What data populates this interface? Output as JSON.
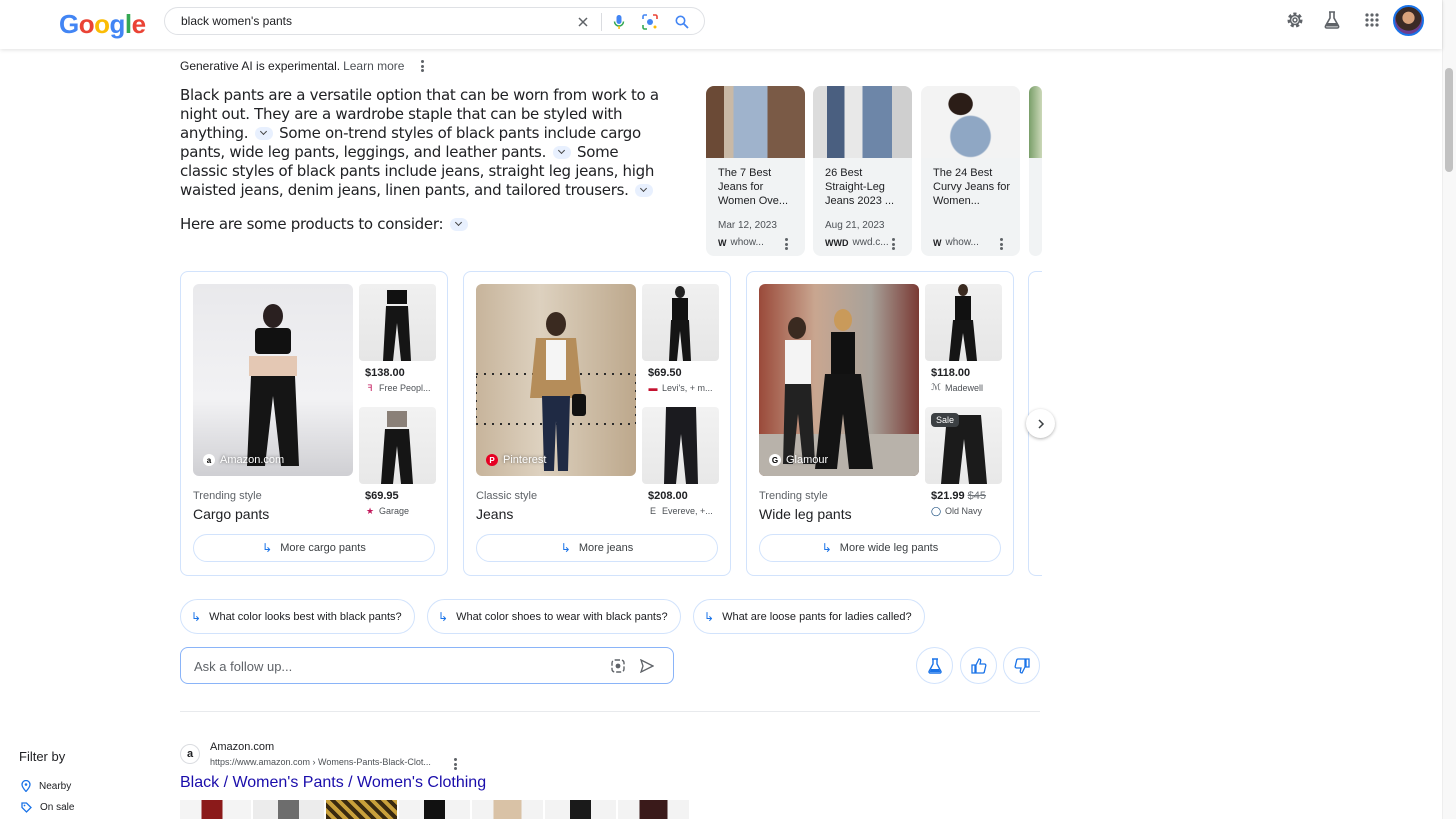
{
  "header": {
    "logo": [
      "G",
      "o",
      "o",
      "g",
      "l",
      "e"
    ],
    "logo_colors": [
      "#4285f4",
      "#ea4335",
      "#fbbc05",
      "#4285f4",
      "#34a853",
      "#ea4335"
    ],
    "query": "black women's pants",
    "icons": [
      "clear-icon",
      "mic-icon",
      "lens-icon",
      "search-icon",
      "settings-icon",
      "labs-icon",
      "apps-icon",
      "avatar"
    ]
  },
  "ai_overview": {
    "gen_note": "Generative AI is experimental.",
    "learn_more": "Learn more",
    "para": [
      "Black pants are a versatile option that can be worn from work to a night out. They are a wardrobe staple that can be styled with anything.",
      "Some on-trend styles of black pants include cargo pants, wide leg pants, leggings, and leather pants.",
      "Some classic styles of black pants include jeans, straight leg jeans, high waisted jeans, denim jeans, linen pants, and tailored trousers."
    ],
    "consider": "Here are some products to consider:",
    "sources": [
      {
        "title": "The 7 Best Jeans for Women Ove...",
        "date": "Mar 12, 2023",
        "site": "whow...",
        "favicon": "W"
      },
      {
        "title": "26 Best Straight-Leg Jeans 2023 ...",
        "date": "Aug 21, 2023",
        "site": "wwd.c...",
        "favicon": "WWD"
      },
      {
        "title": "The 24 Best Curvy Jeans for Women...",
        "date": "",
        "site": "whow...",
        "favicon": "W"
      }
    ]
  },
  "products": [
    {
      "source": "Amazon.com",
      "source_icon": "a",
      "kind": "Trending style",
      "name": "Cargo pants",
      "more": "More cargo pants",
      "items": [
        {
          "price": "$138.00",
          "was": "",
          "merchant": "Free Peopl...",
          "icon": "ꟻ",
          "sale": ""
        },
        {
          "price": "$69.95",
          "was": "",
          "merchant": "Garage",
          "icon": "★",
          "sale": ""
        }
      ]
    },
    {
      "source": "Pinterest",
      "source_icon": "P",
      "kind": "Classic style",
      "name": "Jeans",
      "more": "More jeans",
      "items": [
        {
          "price": "$69.50",
          "was": "",
          "merchant": "Levi's, + m...",
          "icon": "▬",
          "sale": ""
        },
        {
          "price": "$208.00",
          "was": "",
          "merchant": "Evereve, +...",
          "icon": "E",
          "sale": ""
        }
      ]
    },
    {
      "source": "Glamour",
      "source_icon": "G",
      "kind": "Trending style",
      "name": "Wide leg pants",
      "more": "More wide leg pants",
      "items": [
        {
          "price": "$118.00",
          "was": "",
          "merchant": "Madewell",
          "icon": "ℳ",
          "sale": ""
        },
        {
          "price": "$21.99",
          "was": "$45",
          "merchant": "Old Navy",
          "icon": "◯",
          "sale": "Sale"
        }
      ]
    }
  ],
  "related": [
    "What color looks best with black pants?",
    "What color shoes to wear with black pants?",
    "What are loose pants for ladies called?"
  ],
  "ask": {
    "placeholder": "Ask a follow up..."
  },
  "filter": {
    "title": "Filter by",
    "items": [
      "Nearby",
      "On sale"
    ]
  },
  "result": {
    "site": "Amazon.com",
    "favicon": "a",
    "url": "https://www.amazon.com › Womens-Pants-Black-Clot...",
    "title": "Black / Women's Pants / Women's Clothing"
  }
}
